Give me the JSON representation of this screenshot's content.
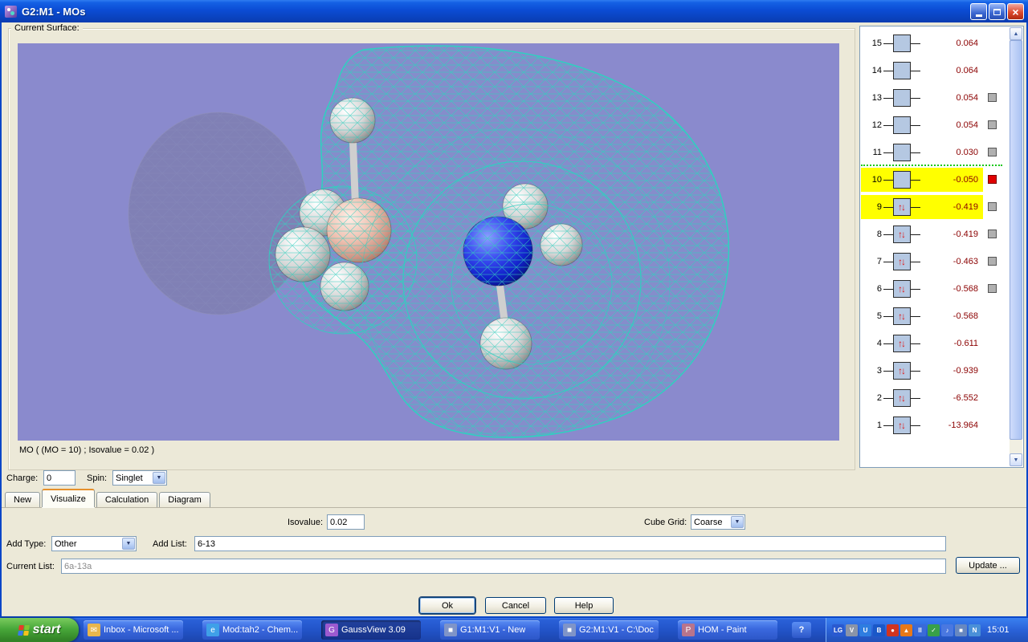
{
  "window": {
    "title": "G2:M1 - MOs",
    "close_glyph": "×"
  },
  "surface": {
    "group_label": "Current Surface:",
    "caption": "MO ( (MO = 10) ; Isovalue = 0.02 )"
  },
  "mo_list": {
    "divider_above": "10",
    "rows": [
      {
        "num": "15",
        "energy": "0.064",
        "occupied": false,
        "checkbox": "none",
        "highlight": false
      },
      {
        "num": "14",
        "energy": "0.064",
        "occupied": false,
        "checkbox": "none",
        "highlight": false
      },
      {
        "num": "13",
        "energy": "0.054",
        "occupied": false,
        "checkbox": "gray",
        "highlight": false
      },
      {
        "num": "12",
        "energy": "0.054",
        "occupied": false,
        "checkbox": "gray",
        "highlight": false
      },
      {
        "num": "11",
        "energy": "0.030",
        "occupied": false,
        "checkbox": "gray",
        "highlight": false
      },
      {
        "num": "10",
        "energy": "-0.050",
        "occupied": false,
        "checkbox": "red",
        "highlight": true
      },
      {
        "num": "9",
        "energy": "-0.419",
        "occupied": true,
        "checkbox": "gray",
        "highlight": true
      },
      {
        "num": "8",
        "energy": "-0.419",
        "occupied": true,
        "checkbox": "gray",
        "highlight": false
      },
      {
        "num": "7",
        "energy": "-0.463",
        "occupied": true,
        "checkbox": "gray",
        "highlight": false
      },
      {
        "num": "6",
        "energy": "-0.568",
        "occupied": true,
        "checkbox": "gray",
        "highlight": false
      },
      {
        "num": "5",
        "energy": "-0.568",
        "occupied": true,
        "checkbox": "none",
        "highlight": false
      },
      {
        "num": "4",
        "energy": "-0.611",
        "occupied": true,
        "checkbox": "none",
        "highlight": false
      },
      {
        "num": "3",
        "energy": "-0.939",
        "occupied": true,
        "checkbox": "none",
        "highlight": false
      },
      {
        "num": "2",
        "energy": "-6.552",
        "occupied": true,
        "checkbox": "none",
        "highlight": false
      },
      {
        "num": "1",
        "energy": "-13.964",
        "occupied": true,
        "checkbox": "none",
        "highlight": false
      }
    ]
  },
  "tabs": [
    {
      "label": "New",
      "active": false
    },
    {
      "label": "Visualize",
      "active": true
    },
    {
      "label": "Calculation",
      "active": false
    },
    {
      "label": "Diagram",
      "active": false
    }
  ],
  "controls": {
    "charge_label": "Charge:",
    "charge_value": "0",
    "spin_label": "Spin:",
    "spin_value": "Singlet",
    "isovalue_label": "Isovalue:",
    "isovalue_value": "0.02",
    "cube_grid_label": "Cube Grid:",
    "cube_grid_value": "Coarse",
    "add_type_label": "Add Type:",
    "add_type_value": "Other",
    "add_list_label": "Add List:",
    "add_list_value": "6-13",
    "current_list_label": "Current List:",
    "current_list_value": "6a-13a",
    "update_button": "Update ...",
    "ok_button": "Ok",
    "cancel_button": "Cancel",
    "help_button": "Help"
  },
  "taskbar": {
    "start_label": "start",
    "items": [
      {
        "label": "Inbox - Microsoft ...",
        "icon": "outlook-icon",
        "glyph": "✉",
        "color": "#e8b64c",
        "active": false
      },
      {
        "label": "Mod:tah2 - Chem...",
        "icon": "internet-explorer-icon",
        "glyph": "e",
        "color": "#3fa0e8",
        "active": false
      },
      {
        "label": "GaussView 3.09",
        "icon": "gaussview-icon",
        "glyph": "G",
        "color": "#9c5ad0",
        "active": true
      },
      {
        "label": "G1:M1:V1 - New",
        "icon": "window-icon",
        "glyph": "■",
        "color": "#7f94c8",
        "active": false
      },
      {
        "label": "G2:M1:V1 - C:\\Doc...",
        "icon": "window-icon",
        "glyph": "■",
        "color": "#7f94c8",
        "active": false
      },
      {
        "label": "HOM - Paint",
        "icon": "paint-icon",
        "glyph": "P",
        "color": "#b8748c",
        "active": false
      }
    ],
    "help_button": "?",
    "tray_icons": [
      {
        "name": "lg-app-icon",
        "glyph": "LG",
        "bg": "#2a5ad0",
        "fg": "#ffffff"
      },
      {
        "name": "vpn-icon",
        "glyph": "V",
        "bg": "#8a94a8",
        "fg": "#ffffff"
      },
      {
        "name": "shield-icon",
        "glyph": "U",
        "bg": "#2e7de0",
        "fg": "#ffffff"
      },
      {
        "name": "bluetooth-icon",
        "glyph": "B",
        "bg": "#1a58c8",
        "fg": "#ffffff"
      },
      {
        "name": "antivirus-icon",
        "glyph": "●",
        "bg": "#d23420",
        "fg": "#ffffff"
      },
      {
        "name": "firewall-icon",
        "glyph": "▲",
        "bg": "#e87818",
        "fg": "#ffffff"
      },
      {
        "name": "signal-icon",
        "glyph": "ll",
        "bg": "#3a6ad8",
        "fg": "#ffffff"
      },
      {
        "name": "status-ok-icon",
        "glyph": "✓",
        "bg": "#38a048",
        "fg": "#ffffff"
      },
      {
        "name": "volume-icon",
        "glyph": "♪",
        "bg": "#4a78e0",
        "fg": "#ffffff"
      },
      {
        "name": "display-icon",
        "glyph": "■",
        "bg": "#6888c0",
        "fg": "#ffffff"
      },
      {
        "name": "network-icon",
        "glyph": "N",
        "bg": "#4a90d8",
        "fg": "#ffffff"
      }
    ],
    "clock": "15:01"
  }
}
